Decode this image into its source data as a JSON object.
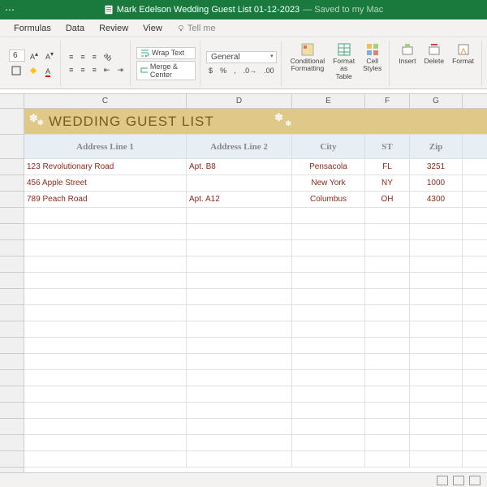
{
  "titlebar": {
    "filename": "Mark Edelson Wedding Guest List 01-12-2023",
    "saved_status": "— Saved to my Mac"
  },
  "menu": {
    "formulas": "Formulas",
    "data": "Data",
    "review": "Review",
    "view": "View",
    "tellme": "Tell me"
  },
  "ribbon": {
    "font_size": "6",
    "wrap_text": "Wrap Text",
    "merge_center": "Merge & Center",
    "number_format": "General",
    "cond_fmt": "Conditional\nFormatting",
    "fmt_table": "Format\nas Table",
    "cell_styles": "Cell\nStyles",
    "insert": "Insert",
    "delete": "Delete",
    "format": "Format"
  },
  "columns": [
    "C",
    "D",
    "E",
    "F",
    "G"
  ],
  "sheet": {
    "title": "WEDDING GUEST LIST",
    "headers": {
      "addr1": "Address Line 1",
      "addr2": "Address Line 2",
      "city": "City",
      "st": "ST",
      "zip": "Zip"
    },
    "rows": [
      {
        "addr1": "123 Revolutionary Road",
        "addr2": "Apt. B8",
        "city": "Pensacola",
        "st": "FL",
        "zip": "3251"
      },
      {
        "addr1": "456 Apple Street",
        "addr2": "",
        "city": "New York",
        "st": "NY",
        "zip": "1000"
      },
      {
        "addr1": "789 Peach Road",
        "addr2": "Apt. A12",
        "city": "Columbus",
        "st": "OH",
        "zip": "4300"
      }
    ]
  }
}
